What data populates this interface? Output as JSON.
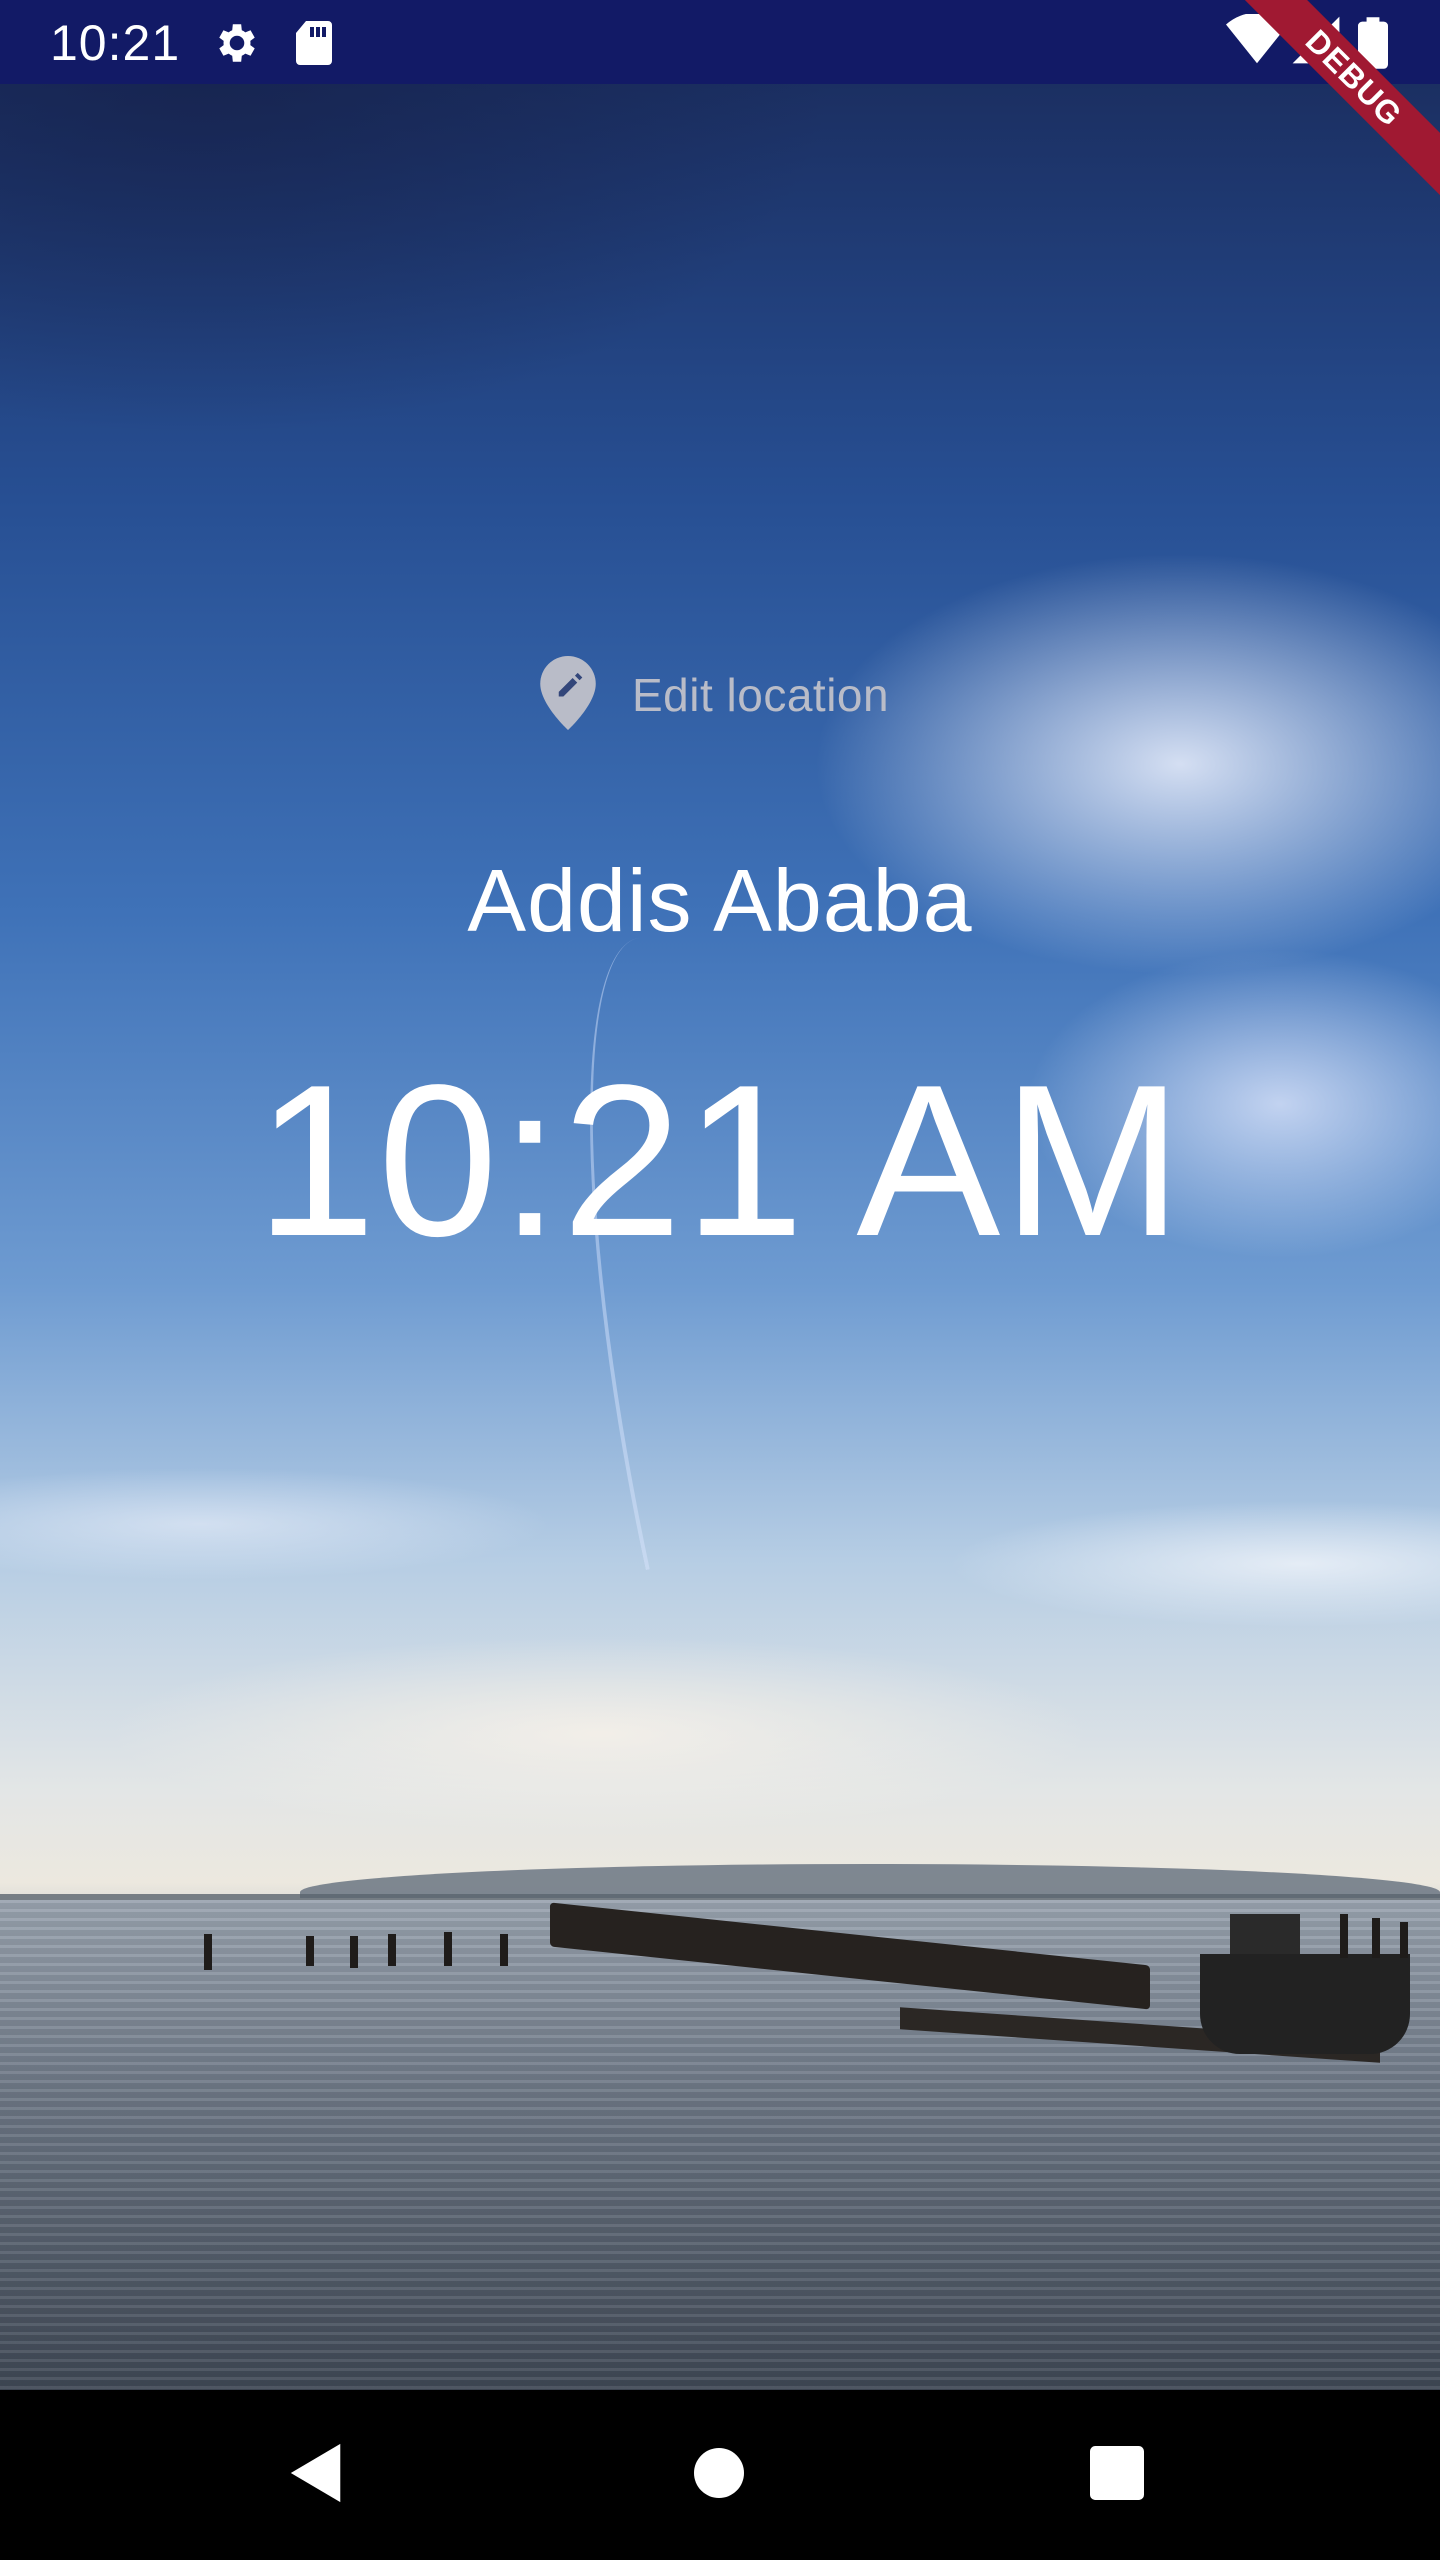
{
  "status_bar": {
    "time": "10:21",
    "background_color": "#121a66",
    "icons": [
      "gear-icon",
      "sd-card-icon",
      "wifi-icon",
      "signal-icon",
      "battery-icon"
    ]
  },
  "debug_banner": {
    "label": "DEBUG",
    "color": "#a01932"
  },
  "main": {
    "edit_location": {
      "label": "Edit location",
      "icon": "location-pin-edit-icon"
    },
    "location": "Addis Ababa",
    "time": "10:21 AM"
  },
  "nav_bar": {
    "buttons": [
      "back-icon",
      "home-icon",
      "recents-icon"
    ]
  }
}
